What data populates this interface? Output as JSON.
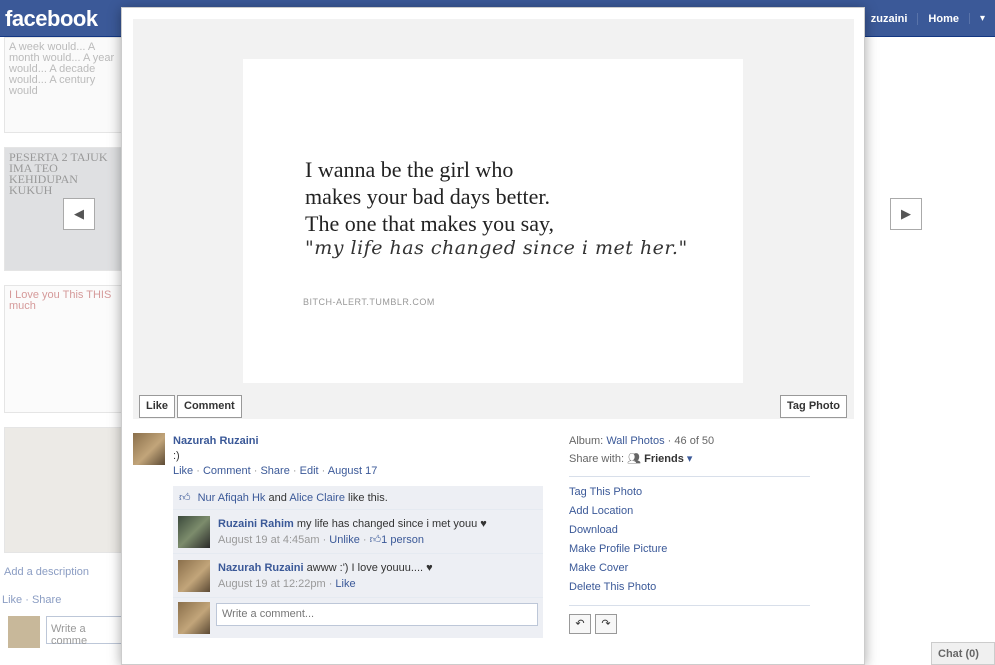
{
  "topbar": {
    "logo": "facebook",
    "nav_name": "zuzaini",
    "nav_home": "Home",
    "nav_caret": "▾"
  },
  "background": {
    "thumb1_text": "A week would... A month would... A year would... A decade would... A century would",
    "thumb2_text": "PESERTA 2 TAJUK IMA TEO KEHIDUPAN KUKUH",
    "thumb3_text": "I Love you This THIS much",
    "add_description": "Add a description",
    "like": "Like",
    "share": "Share",
    "comment_placeholder": "Write a comme",
    "chat_label": "Chat (0)"
  },
  "navigation": {
    "prev_icon": "◀",
    "next_icon": "▶"
  },
  "photo": {
    "quote_line1": "I wanna be the girl who",
    "quote_line2": "makes your bad days better.",
    "quote_line3": "The one that makes you say,",
    "quote_script": "\"my life has changed since i met her.\"",
    "credit": "BITCH-ALERT.TUMBLR.COM",
    "like_label": "Like",
    "comment_label": "Comment",
    "tag_label": "Tag Photo"
  },
  "post": {
    "owner": "Nazurah Ruzaini",
    "caption": ":)",
    "action_like": "Like",
    "action_comment": "Comment",
    "action_share": "Share",
    "action_edit": "Edit",
    "date": "August 17",
    "sep": "·"
  },
  "likes": {
    "person1": "Nur Afiqah Hk",
    "and": "and",
    "person2": "Alice Claire",
    "suffix": "like this."
  },
  "comments": [
    {
      "author": "Ruzaini Rahim",
      "text": "my life has changed since i met youu ♥",
      "time": "August 19 at 4:45am",
      "action": "Unlike",
      "likes": "1 person"
    },
    {
      "author": "Nazurah Ruzaini",
      "text": "awww :') I love youuu.... ♥",
      "time": "August 19 at 12:22pm",
      "action": "Like"
    }
  ],
  "comment_box": {
    "placeholder": "Write a comment..."
  },
  "details": {
    "album_label": "Album:",
    "album_name": "Wall Photos",
    "position": "46 of 50",
    "share_label": "Share with:",
    "share_value": "Friends",
    "options": [
      "Tag This Photo",
      "Add Location",
      "Download",
      "Make Profile Picture",
      "Make Cover",
      "Delete This Photo"
    ],
    "rotate_left": "↶",
    "rotate_right": "↷"
  }
}
